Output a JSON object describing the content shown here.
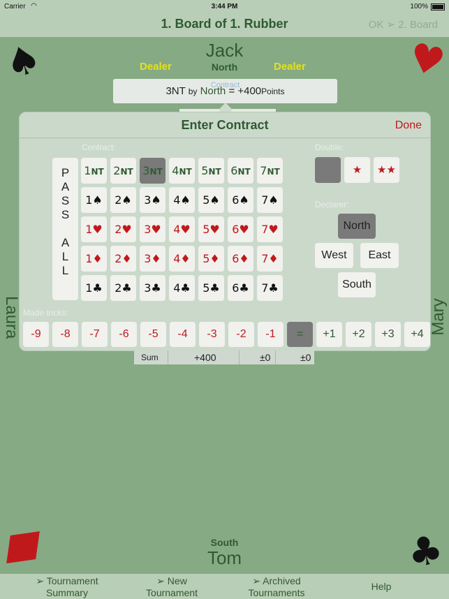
{
  "status": {
    "carrier": "Carrier",
    "time": "3:44 PM",
    "battery": "100%"
  },
  "nav": {
    "title": "1. Board of 1. Rubber",
    "next": "OK ➢ 2. Board"
  },
  "players": {
    "north_name": "Jack",
    "north_seat": "North",
    "south_name": "Tom",
    "south_seat": "South",
    "west_name": "Laura",
    "east_name": "Mary",
    "dealer_left": "Dealer",
    "dealer_right": "Dealer"
  },
  "contract_summary": {
    "ghost": "Contract",
    "level": "3NT",
    "by": "by",
    "declarer": "North",
    "score": "= +400",
    "points": "Points"
  },
  "popup": {
    "title": "Enter Contract",
    "done": "Done",
    "contract_label": "Contract:",
    "double_label": "Double:",
    "declarer_label": "Declarer:",
    "tricks_label": "Made tricks:",
    "pass_letters": [
      "P",
      "A",
      "S",
      "S",
      "",
      "A",
      "L",
      "L"
    ],
    "nt_row": [
      "1",
      "2",
      "3",
      "4",
      "5",
      "6",
      "7"
    ],
    "nt_suffix": "NT",
    "suit_rows": [
      {
        "suit": "♠",
        "color": "#111111"
      },
      {
        "suit": "♥",
        "color": "#c0191c"
      },
      {
        "suit": "♦",
        "color": "#c0191c"
      },
      {
        "suit": "♣",
        "color": "#111111"
      }
    ],
    "selected_contract": "3NT",
    "double_options": [
      "",
      "★",
      "★★"
    ],
    "declarers": {
      "north": "North",
      "west": "West",
      "east": "East",
      "south": "South"
    },
    "selected_declarer": "North",
    "tricks": [
      "-9",
      "-8",
      "-7",
      "-6",
      "-5",
      "-4",
      "-3",
      "-2",
      "-1",
      "=",
      "+1",
      "+2",
      "+3",
      "+4"
    ]
  },
  "sum": {
    "label": "Sum",
    "v1": "+400",
    "v2": "±0",
    "v3": "±0"
  },
  "tabs": [
    {
      "line1": "➢ Tournament",
      "line2": "Summary"
    },
    {
      "line1": "➢ New",
      "line2": "Tournament"
    },
    {
      "line1": "➢ Archived",
      "line2": "Tournaments"
    },
    {
      "line1": "Help",
      "line2": ""
    }
  ],
  "icons": {
    "top_left": "spade-icon",
    "top_right": "heart-icon",
    "bottom_left": "diamond-icon",
    "bottom_right": "club-icon"
  },
  "colors": {
    "background": "#86aa84",
    "accent_green": "#2f5a30",
    "red": "#c0191c",
    "dealer_yellow": "#e3e21c"
  }
}
